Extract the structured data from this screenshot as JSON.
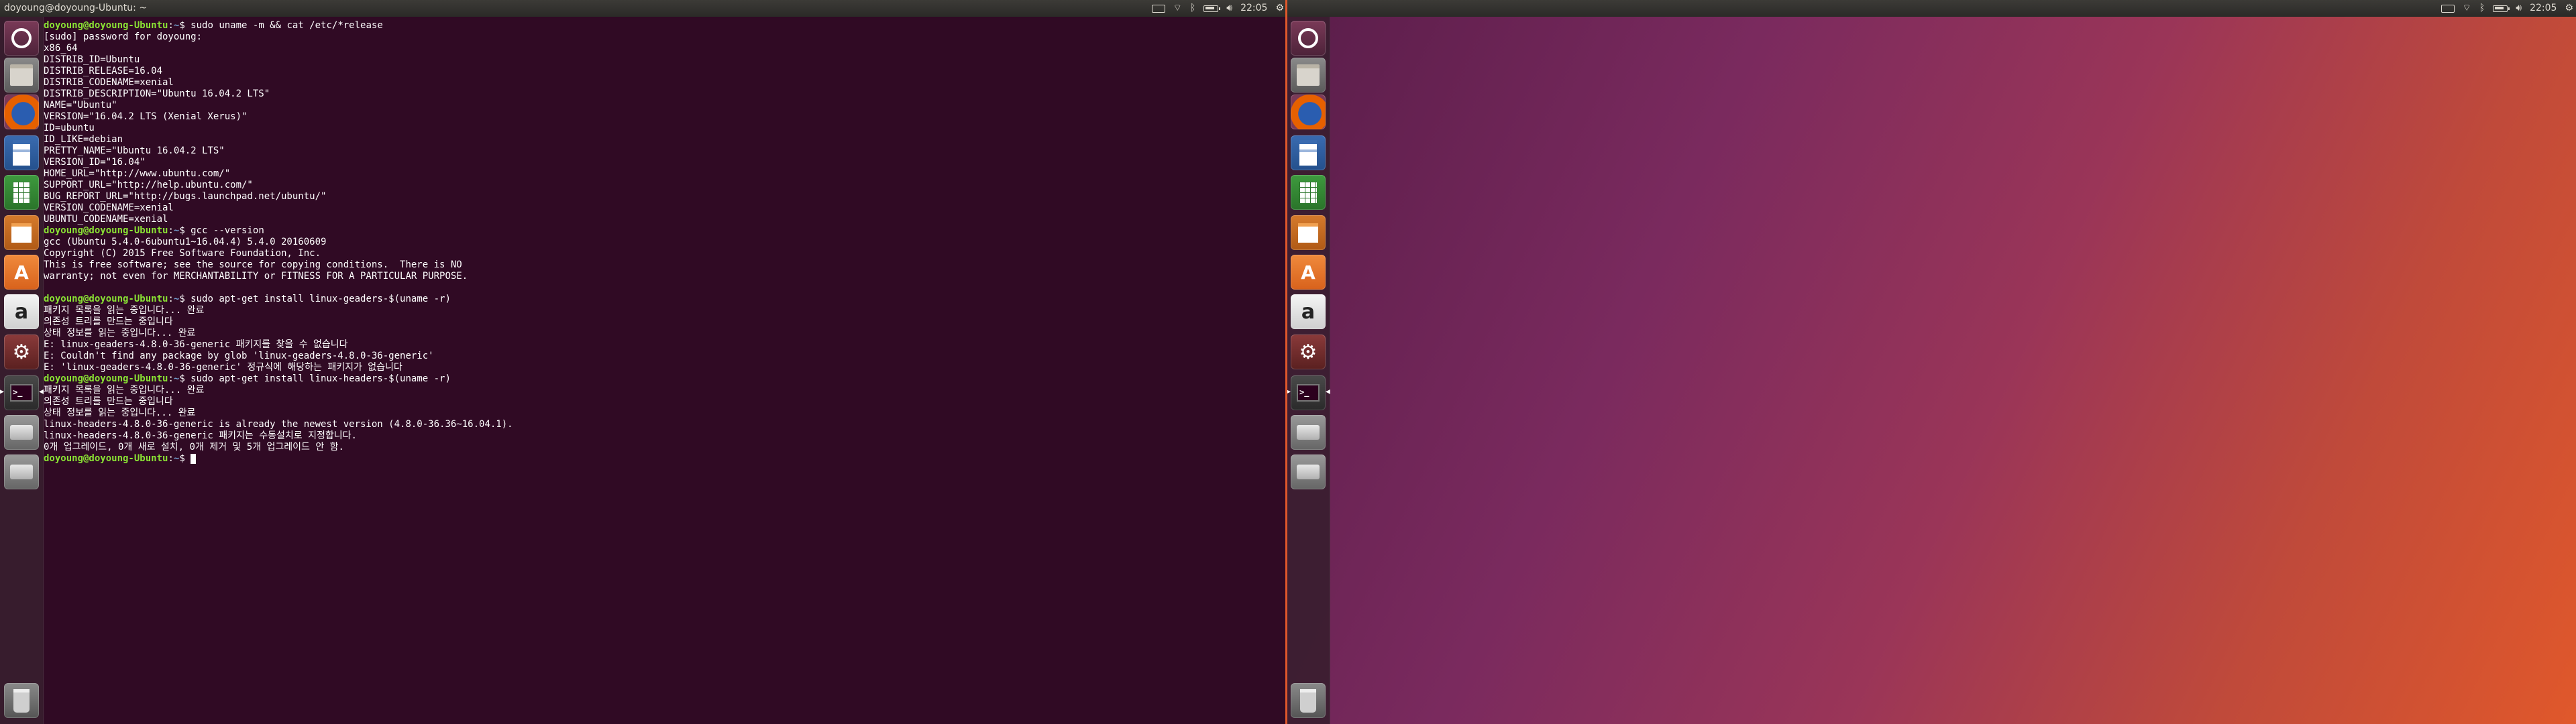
{
  "left_screen": {
    "window_title": "doyoung@doyoung-Ubuntu: ~",
    "clock": "22:05",
    "terminal_lines": [
      {
        "prompt": "doyoung@doyoung-Ubuntu",
        "path": "~",
        "cmd": "sudo uname -m && cat /etc/*release"
      },
      {
        "text": "[sudo] password for doyoung:"
      },
      {
        "text": "x86_64"
      },
      {
        "text": "DISTRIB_ID=Ubuntu"
      },
      {
        "text": "DISTRIB_RELEASE=16.04"
      },
      {
        "text": "DISTRIB_CODENAME=xenial"
      },
      {
        "text": "DISTRIB_DESCRIPTION=\"Ubuntu 16.04.2 LTS\""
      },
      {
        "text": "NAME=\"Ubuntu\""
      },
      {
        "text": "VERSION=\"16.04.2 LTS (Xenial Xerus)\""
      },
      {
        "text": "ID=ubuntu"
      },
      {
        "text": "ID_LIKE=debian"
      },
      {
        "text": "PRETTY_NAME=\"Ubuntu 16.04.2 LTS\""
      },
      {
        "text": "VERSION_ID=\"16.04\""
      },
      {
        "text": "HOME_URL=\"http://www.ubuntu.com/\""
      },
      {
        "text": "SUPPORT_URL=\"http://help.ubuntu.com/\""
      },
      {
        "text": "BUG_REPORT_URL=\"http://bugs.launchpad.net/ubuntu/\""
      },
      {
        "text": "VERSION_CODENAME=xenial"
      },
      {
        "text": "UBUNTU_CODENAME=xenial"
      },
      {
        "prompt": "doyoung@doyoung-Ubuntu",
        "path": "~",
        "cmd": "gcc --version"
      },
      {
        "text": "gcc (Ubuntu 5.4.0-6ubuntu1~16.04.4) 5.4.0 20160609"
      },
      {
        "text": "Copyright (C) 2015 Free Software Foundation, Inc."
      },
      {
        "text": "This is free software; see the source for copying conditions.  There is NO"
      },
      {
        "text": "warranty; not even for MERCHANTABILITY or FITNESS FOR A PARTICULAR PURPOSE."
      },
      {
        "text": ""
      },
      {
        "prompt": "doyoung@doyoung-Ubuntu",
        "path": "~",
        "cmd": "sudo apt-get install linux-geaders-$(uname -r)"
      },
      {
        "text": "패키지 목록을 읽는 중입니다... 완료"
      },
      {
        "text": "의존성 트리를 만드는 중입니다"
      },
      {
        "text": "상태 정보를 읽는 중입니다... 완료"
      },
      {
        "text": "E: linux-geaders-4.8.0-36-generic 패키지를 찾을 수 없습니다"
      },
      {
        "text": "E: Couldn't find any package by glob 'linux-geaders-4.8.0-36-generic'"
      },
      {
        "text": "E: 'linux-geaders-4.8.0-36-generic' 정규식에 해당하는 패키지가 없습니다"
      },
      {
        "prompt": "doyoung@doyoung-Ubuntu",
        "path": "~",
        "cmd": "sudo apt-get install linux-headers-$(uname -r)"
      },
      {
        "text": "패키지 목록을 읽는 중입니다... 완료"
      },
      {
        "text": "의존성 트리를 만드는 중입니다"
      },
      {
        "text": "상태 정보를 읽는 중입니다... 완료"
      },
      {
        "text": "linux-headers-4.8.0-36-generic is already the newest version (4.8.0-36.36~16.04.1)."
      },
      {
        "text": "linux-headers-4.8.0-36-generic 패키지는 수동설치로 지정합니다."
      },
      {
        "text": "0개 업그레이드, 0개 새로 설치, 0개 제거 및 5개 업그레이드 안 함."
      },
      {
        "prompt": "doyoung@doyoung-Ubuntu",
        "path": "~",
        "cmd": "",
        "cursor": true
      }
    ]
  },
  "right_screen": {
    "clock": "22:05"
  },
  "launcher_icons": [
    {
      "name": "dash-icon",
      "active": false
    },
    {
      "name": "files-icon",
      "active": false
    },
    {
      "name": "firefox-icon",
      "active": false
    },
    {
      "name": "libreoffice-writer-icon",
      "active": false
    },
    {
      "name": "libreoffice-calc-icon",
      "active": false
    },
    {
      "name": "libreoffice-impress-icon",
      "active": false
    },
    {
      "name": "ubuntu-software-icon",
      "active": false
    },
    {
      "name": "amazon-icon",
      "active": false
    },
    {
      "name": "system-settings-icon",
      "active": false
    },
    {
      "name": "terminal-icon",
      "active": true
    },
    {
      "name": "drive-icon",
      "active": false
    },
    {
      "name": "drive-icon",
      "active": false
    },
    {
      "name": "trash-icon",
      "active": false
    }
  ],
  "indicator_icons": [
    "keyboard-icon",
    "wifi-icon",
    "bluetooth-icon",
    "battery-icon",
    "volume-icon",
    "gear-icon"
  ],
  "colors": {
    "terminal_bg": "#300a24",
    "prompt_user": "#8ae234",
    "prompt_path": "#729fcf",
    "monitor_divider": "#e0582b"
  }
}
